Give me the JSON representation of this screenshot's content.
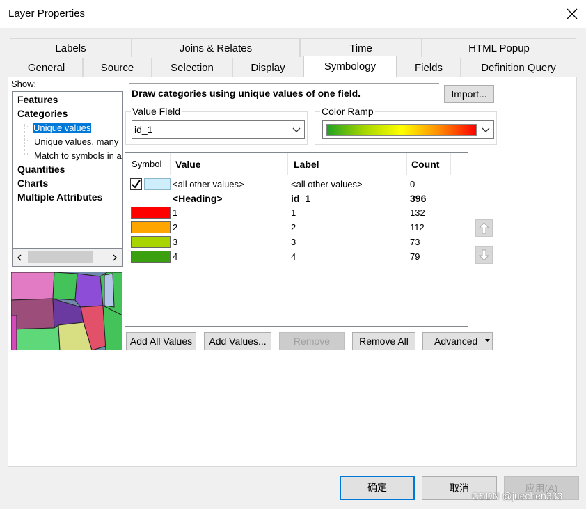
{
  "window": {
    "title": "Layer Properties"
  },
  "tabs_top": [
    {
      "label": "Labels"
    },
    {
      "label": "Joins & Relates"
    },
    {
      "label": "Time"
    },
    {
      "label": "HTML Popup"
    }
  ],
  "tabs_bottom": [
    {
      "label": "General"
    },
    {
      "label": "Source"
    },
    {
      "label": "Selection"
    },
    {
      "label": "Display"
    },
    {
      "label": "Symbology"
    },
    {
      "label": "Fields"
    },
    {
      "label": "Definition Query"
    }
  ],
  "show": {
    "label": "Show:",
    "items": [
      {
        "label": "Features"
      },
      {
        "label": "Categories"
      },
      {
        "label": "Unique values"
      },
      {
        "label": "Unique values, many"
      },
      {
        "label": "Match to symbols in a"
      },
      {
        "label": "Quantities"
      },
      {
        "label": "Charts"
      },
      {
        "label": "Multiple Attributes"
      }
    ]
  },
  "description": "Draw categories using unique values of one field.",
  "import_label": "Import...",
  "value_field": {
    "label": "Value Field",
    "value": "id_1"
  },
  "color_ramp": {
    "label": "Color Ramp",
    "colors": [
      "#22a122",
      "#a6d600",
      "#ffff00",
      "#ff8c00",
      "#ff0000"
    ]
  },
  "table": {
    "headers": {
      "symbol": "Symbol",
      "value": "Value",
      "label": "Label",
      "count": "Count"
    },
    "rows": [
      {
        "value": "<all other values>",
        "label": "<all other values>",
        "count": "0",
        "color": "#cdeefa",
        "checked": true
      },
      {
        "value": "<Heading>",
        "label": "id_1",
        "count": "396",
        "heading": true
      },
      {
        "value": "1",
        "label": "1",
        "count": "132",
        "color": "#ff0000"
      },
      {
        "value": "2",
        "label": "2",
        "count": "112",
        "color": "#ffa500"
      },
      {
        "value": "3",
        "label": "3",
        "count": "73",
        "color": "#a8d400"
      },
      {
        "value": "4",
        "label": "4",
        "count": "79",
        "color": "#3aa010"
      }
    ]
  },
  "buttons": {
    "add_all": "Add All Values",
    "add": "Add Values...",
    "remove": "Remove",
    "remove_all": "Remove All",
    "advanced": "Advanced"
  },
  "footer": {
    "ok": "确定",
    "cancel": "取消",
    "apply": "应用(A)"
  },
  "watermark": "CSDN @juechen333"
}
